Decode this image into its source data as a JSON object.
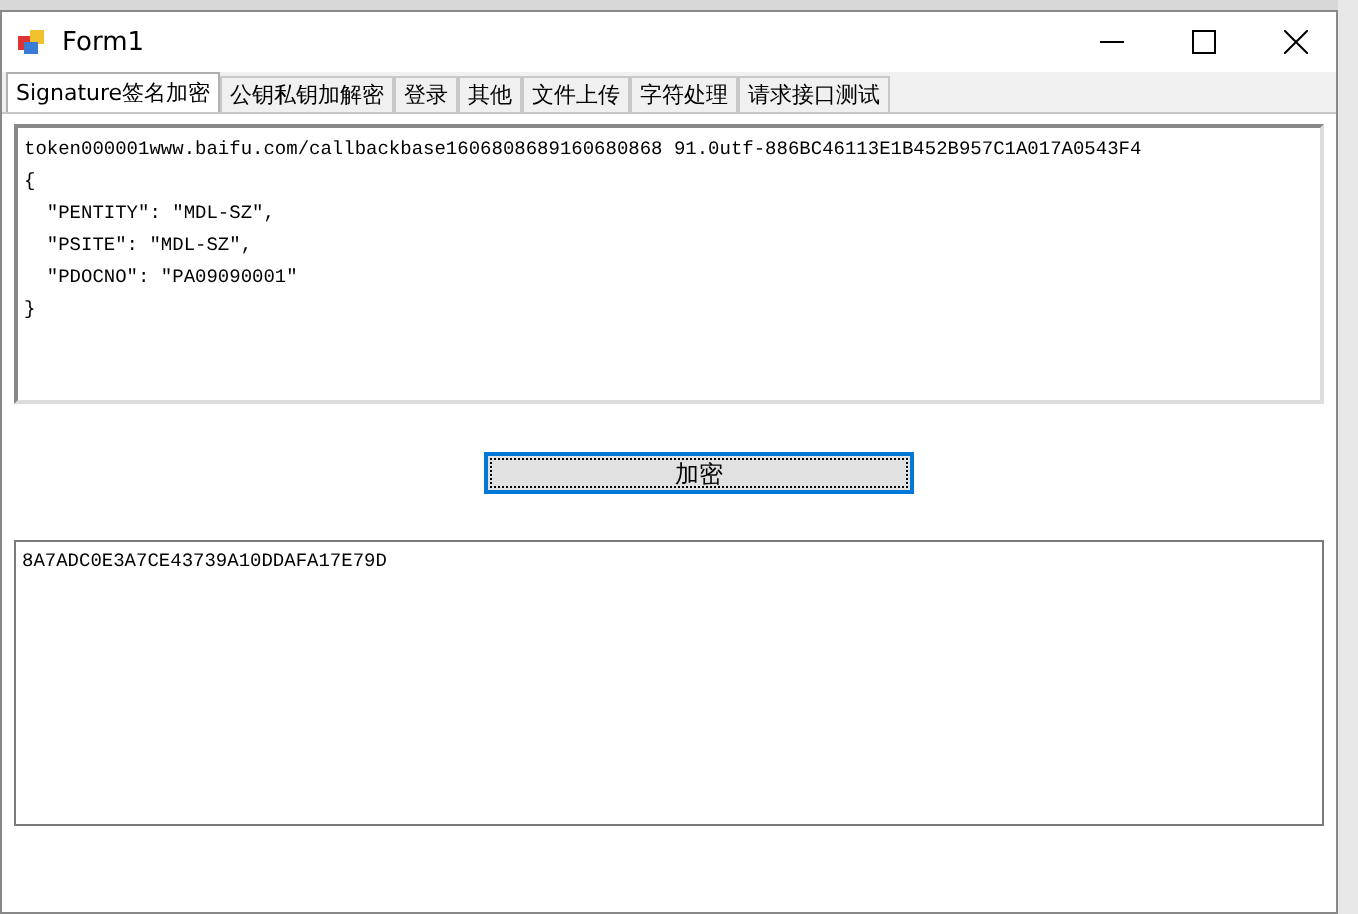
{
  "window": {
    "title": "Form1"
  },
  "tabs": [
    {
      "label": "Signature签名加密",
      "selected": true
    },
    {
      "label": "公钥私钥加解密",
      "selected": false
    },
    {
      "label": "登录",
      "selected": false
    },
    {
      "label": "其他",
      "selected": false
    },
    {
      "label": "文件上传",
      "selected": false
    },
    {
      "label": "字符处理",
      "selected": false
    },
    {
      "label": "请求接口测试",
      "selected": false
    }
  ],
  "input_text": [
    "token000001www.baifu.com/callbackbase1606808689160680868 91.0utf-886BC46113E1B452B957C1A017A0543F4",
    "{",
    "  \"PENTITY\": \"MDL-SZ\",",
    "  \"PSITE\": \"MDL-SZ\",",
    "  \"PDOCNO\": \"PA09090001\"",
    "}"
  ],
  "encrypt_button": "加密",
  "output_text": "8A7ADC0E3A7CE43739A10DDAFA17E79D"
}
